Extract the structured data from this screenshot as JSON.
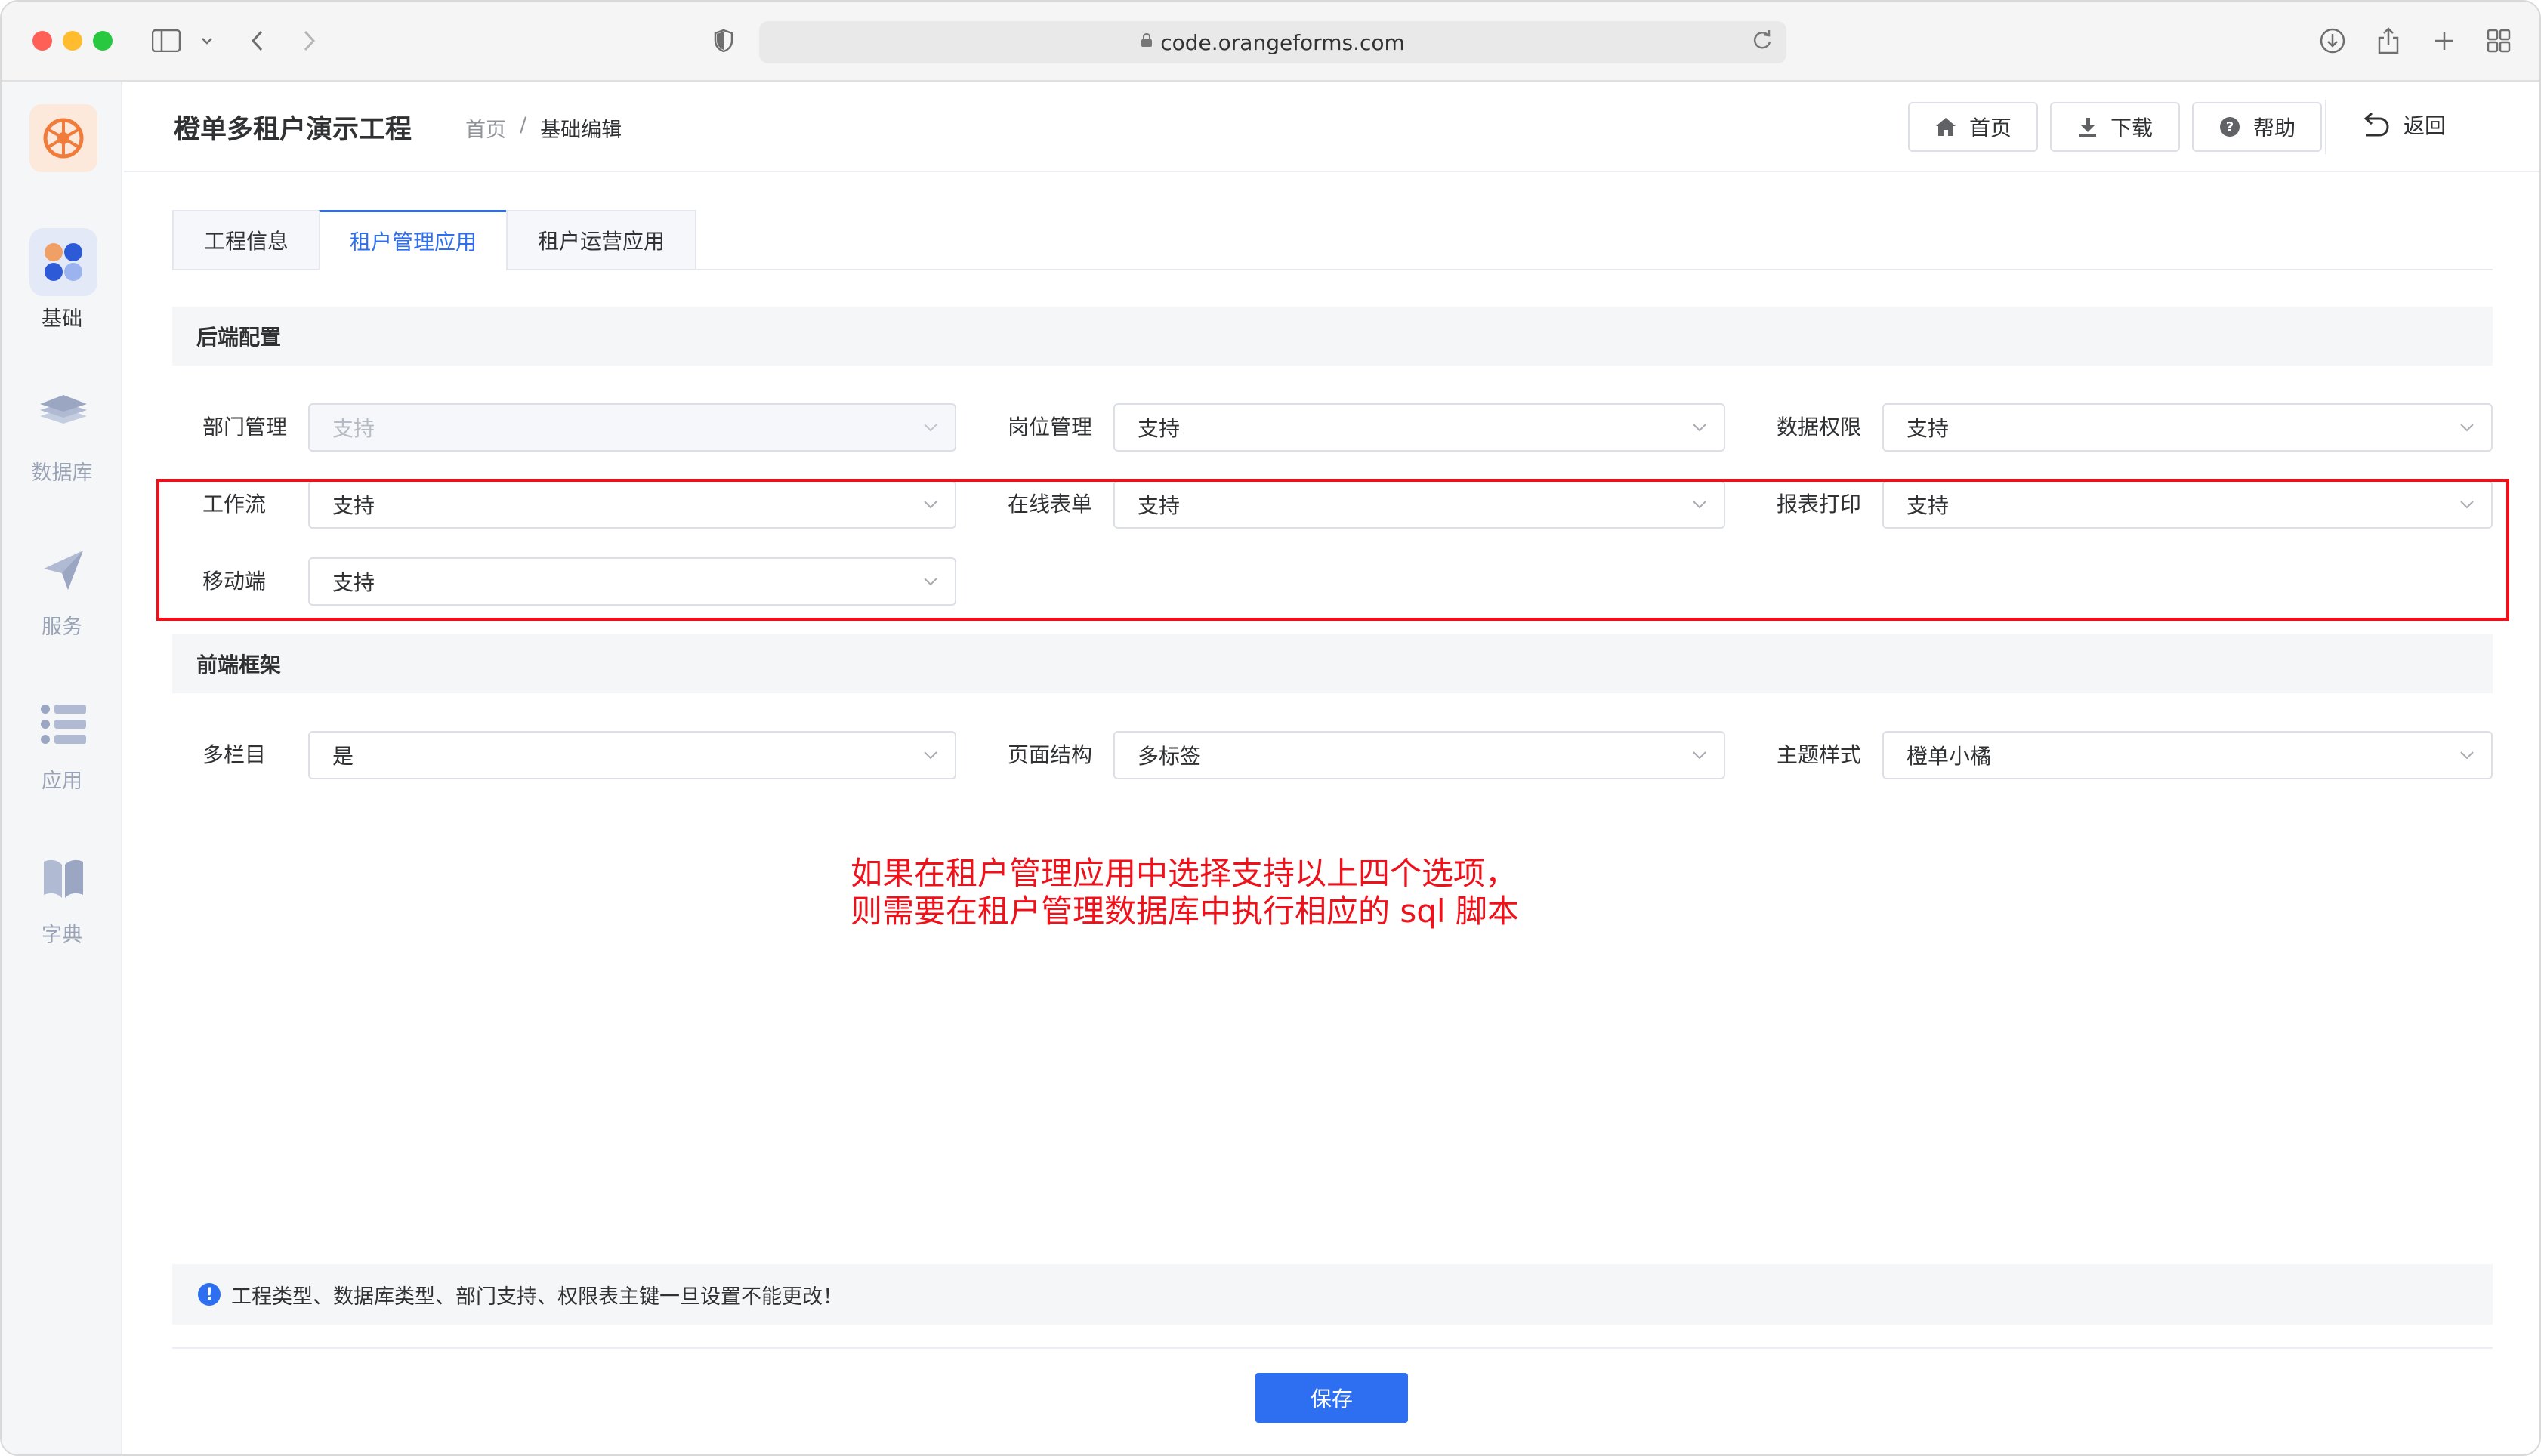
{
  "browser": {
    "url": "code.orangeforms.com"
  },
  "sidebar": {
    "items": [
      {
        "label": "基础",
        "icon": "apps-icon",
        "active": true
      },
      {
        "label": "数据库",
        "icon": "layers-icon",
        "active": false
      },
      {
        "label": "服务",
        "icon": "send-icon",
        "active": false
      },
      {
        "label": "应用",
        "icon": "list-icon",
        "active": false
      },
      {
        "label": "字典",
        "icon": "book-icon",
        "active": false
      }
    ]
  },
  "header": {
    "title": "橙单多租户演示工程",
    "breadcrumb": {
      "home": "首页",
      "separator": "/",
      "current": "基础编辑"
    },
    "buttons": {
      "home": "首页",
      "download": "下载",
      "help": "帮助",
      "back": "返回"
    }
  },
  "tabs": [
    {
      "label": "工程信息",
      "active": false
    },
    {
      "label": "租户管理应用",
      "active": true
    },
    {
      "label": "租户运营应用",
      "active": false
    }
  ],
  "backend": {
    "title": "后端配置",
    "fields": {
      "dept": {
        "label": "部门管理",
        "value": "支持",
        "disabled": true
      },
      "post": {
        "label": "岗位管理",
        "value": "支持"
      },
      "data_perm": {
        "label": "数据权限",
        "value": "支持"
      },
      "workflow": {
        "label": "工作流",
        "value": "支持"
      },
      "online_form": {
        "label": "在线表单",
        "value": "支持"
      },
      "report_print": {
        "label": "报表打印",
        "value": "支持"
      },
      "mobile": {
        "label": "移动端",
        "value": "支持"
      }
    }
  },
  "frontend": {
    "title": "前端框架",
    "fields": {
      "multi_column": {
        "label": "多栏目",
        "value": "是"
      },
      "page_structure": {
        "label": "页面结构",
        "value": "多标签"
      },
      "theme": {
        "label": "主题样式",
        "value": "橙单小橘"
      }
    }
  },
  "annotation": {
    "line1": "如果在租户管理应用中选择支持以上四个选项，",
    "line2": "则需要在租户管理数据库中执行相应的 sql 脚本"
  },
  "notice": {
    "text": "工程类型、数据库类型、部门支持、权限表主键一旦设置不能更改！"
  },
  "footer": {
    "save_label": "保存"
  },
  "colors": {
    "primary": "#2d6ff0",
    "annotation_red": "#f0101a",
    "brand_orange": "#f07b3a"
  }
}
